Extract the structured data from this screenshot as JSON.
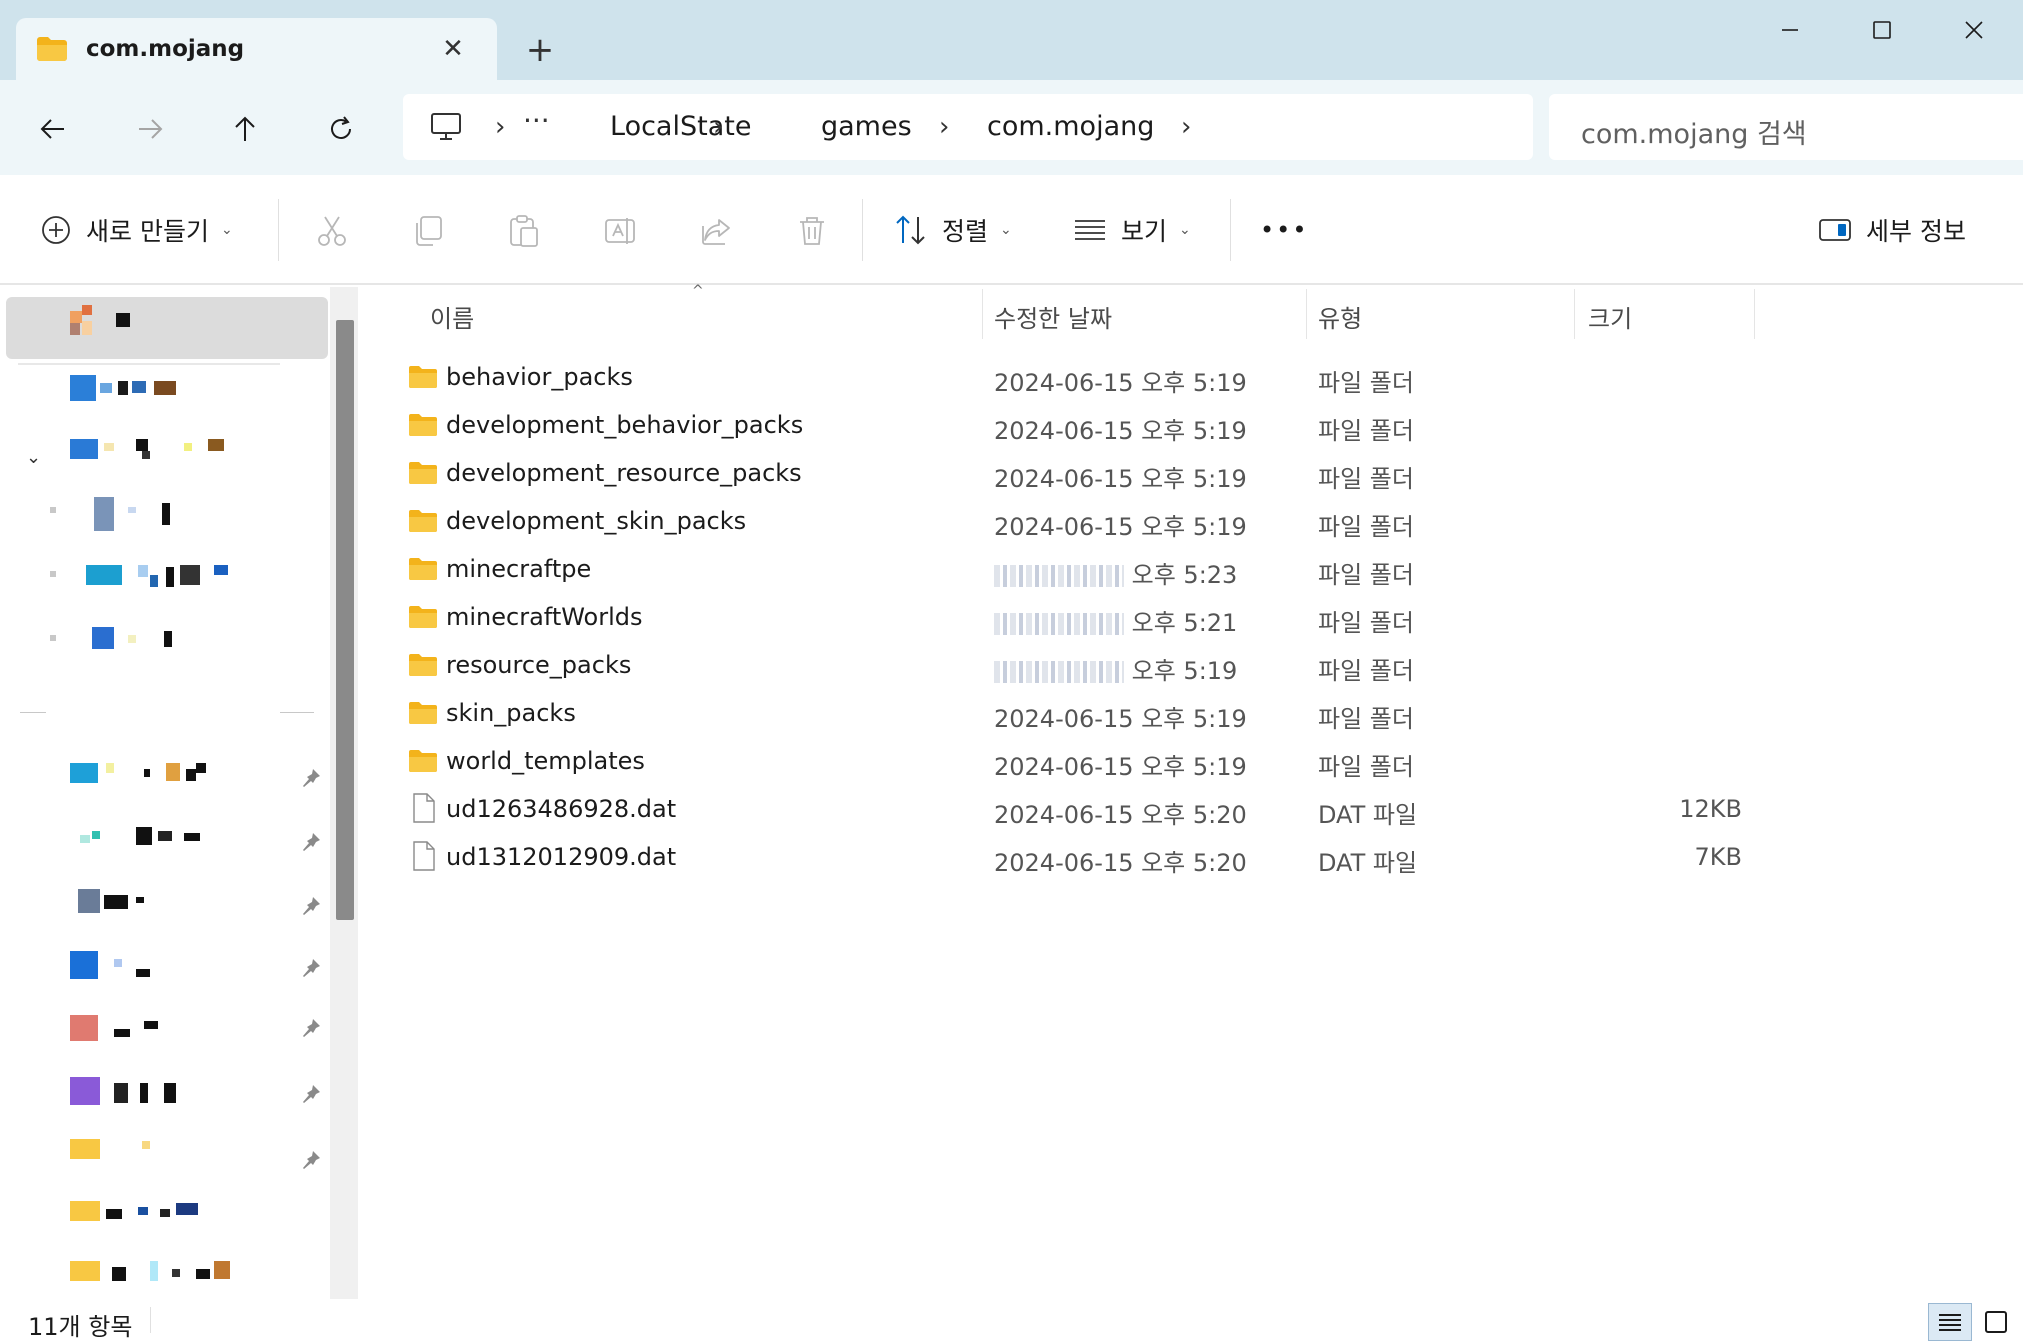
{
  "tab": {
    "title": "com.mojang",
    "close": "✕",
    "new_tab": "+"
  },
  "window": {
    "minimize": "—",
    "maximize": "☐",
    "close": "✕"
  },
  "address": {
    "more": "···",
    "crumbs": [
      "LocalState",
      "games",
      "com.mojang"
    ],
    "separator": "›"
  },
  "search": {
    "placeholder": "com.mojang 검색"
  },
  "toolbar": {
    "new_label": "새로 만들기",
    "sort_label": "정렬",
    "view_label": "보기",
    "more": "•••",
    "details_label": "세부 정보"
  },
  "columns": {
    "name": "이름",
    "modified": "수정한 날짜",
    "type": "유형",
    "size": "크기"
  },
  "files": [
    {
      "name": "behavior_packs",
      "date": "2024-06-15 오후 5:19",
      "type": "파일 폴더",
      "size": "",
      "kind": "folder"
    },
    {
      "name": "development_behavior_packs",
      "date": "2024-06-15 오후 5:19",
      "type": "파일 폴더",
      "size": "",
      "kind": "folder"
    },
    {
      "name": "development_resource_packs",
      "date": "2024-06-15 오후 5:19",
      "type": "파일 폴더",
      "size": "",
      "kind": "folder"
    },
    {
      "name": "development_skin_packs",
      "date": "2024-06-15 오후 5:19",
      "type": "파일 폴더",
      "size": "",
      "kind": "folder"
    },
    {
      "name": "minecraftpe",
      "date": "오후 5:23",
      "type": "파일 폴더",
      "size": "",
      "kind": "folder",
      "date_obscured": true
    },
    {
      "name": "minecraftWorlds",
      "date": "오후 5:21",
      "type": "파일 폴더",
      "size": "",
      "kind": "folder",
      "date_obscured": true
    },
    {
      "name": "resource_packs",
      "date": "오후 5:19",
      "type": "파일 폴더",
      "size": "",
      "kind": "folder",
      "date_obscured": true
    },
    {
      "name": "skin_packs",
      "date": "2024-06-15 오후 5:19",
      "type": "파일 폴더",
      "size": "",
      "kind": "folder"
    },
    {
      "name": "world_templates",
      "date": "2024-06-15 오후 5:19",
      "type": "파일 폴더",
      "size": "",
      "kind": "folder"
    },
    {
      "name": "ud1263486928.dat",
      "date": "2024-06-15 오후 5:20",
      "type": "DAT 파일",
      "size": "12KB",
      "kind": "file"
    },
    {
      "name": "ud1312012909.dat",
      "date": "2024-06-15 오후 5:20",
      "type": "DAT 파일",
      "size": "7KB",
      "kind": "file"
    }
  ],
  "status": {
    "count": "11개 항목"
  },
  "colors": {
    "titlebar": "#cfe3ec",
    "accent": "#0067c0",
    "folder": "#f8c843"
  }
}
